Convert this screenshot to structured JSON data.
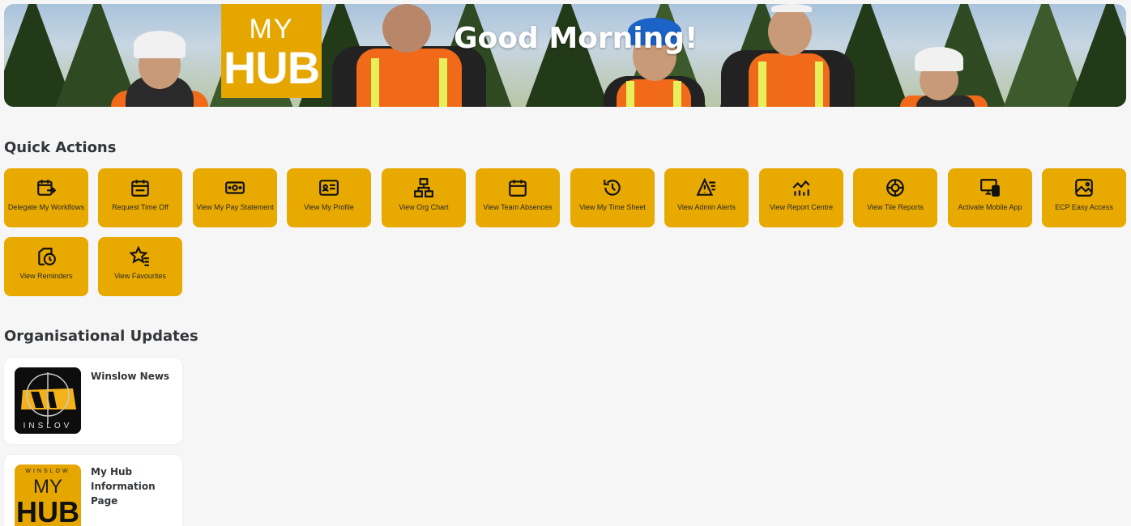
{
  "banner": {
    "greeting": "Good Morning!",
    "logo_line1": "MY",
    "logo_line2": "HUB"
  },
  "quick_actions": {
    "title": "Quick Actions",
    "tiles": [
      {
        "label": "Delegate My Workflows",
        "icon": "delegate-icon"
      },
      {
        "label": "Request Time Off",
        "icon": "calendar-icon"
      },
      {
        "label": "View My Pay Statement",
        "icon": "money-icon"
      },
      {
        "label": "View My Profile",
        "icon": "profile-card-icon"
      },
      {
        "label": "View Org Chart",
        "icon": "org-chart-icon"
      },
      {
        "label": "View Team Absences",
        "icon": "calendar-icon"
      },
      {
        "label": "View My Time Sheet",
        "icon": "history-icon"
      },
      {
        "label": "View Admin Alerts",
        "icon": "alert-list-icon"
      },
      {
        "label": "View Report Centre",
        "icon": "line-chart-icon"
      },
      {
        "label": "View Tile Reports",
        "icon": "target-icon"
      },
      {
        "label": "Activate Mobile App",
        "icon": "desktop-mobile-icon"
      },
      {
        "label": "ECP Easy Access",
        "icon": "image-icon"
      },
      {
        "label": "View Reminders",
        "icon": "reminder-icon"
      },
      {
        "label": "View Favourites",
        "icon": "favourite-list-icon"
      }
    ]
  },
  "updates": {
    "title": "Organisational Updates",
    "cards": [
      {
        "title": "Winslow News",
        "logo_text": "INSLOV"
      },
      {
        "title": "My Hub Information Page",
        "logo_top": "WINSLOW",
        "logo_mid": "MY",
        "logo_bottom": "HUB"
      }
    ]
  },
  "colors": {
    "tile": "#e8a900",
    "logo": "#e6a600",
    "background": "#f6f6f6"
  }
}
